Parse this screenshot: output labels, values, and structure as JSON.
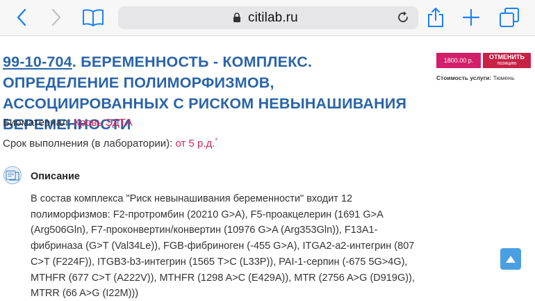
{
  "browser": {
    "url": "citilab.ru"
  },
  "test": {
    "code": "99-10-704",
    "title_rest": ". БЕРЕМЕННОСТЬ - КОМПЛЕКС. ОПРЕДЕЛЕНИЕ ПОЛИМОРФИЗМОВ, АССОЦИИРОВАННЫХ С РИСКОМ НЕВЫНАШИВАНИЯ БЕРЕМЕННОСТИ",
    "price": "1800.00 р.",
    "cancel_line1": "ОТМЕНИТЬ",
    "cancel_line2": "позицию",
    "cost_label": "Стоимость услуги:",
    "cost_city": "Тюмень",
    "biomaterial_label": "Биоматериал:",
    "biomaterial_value": "Кровь ЭДТА",
    "term_label": "Срок выполнения (в лаборатории):",
    "term_value": "от 5 р.д.",
    "term_star": "*"
  },
  "description": {
    "heading": "Описание",
    "text": "В состав комплекса \"Риск невынашивания беременности\" входит 12 полиморфизмов: F2-протромбин (20210 G>A), F5-проакцелерин (1691 G>A (Arg506Gln), F7-проконвертин/конвертин (10976 G>A (Arg353Gln)), F13A1-фибриназа (G>T (Val34Le)), FGB-фибриноген (-455 G>A), ITGA2-а2-интегрин (807 C>T (F224F)), ITGB3-b3-интегрин (1565 T>C (L33P)), PAI-1-серпин (-675 5G>4G), MTHFR (677 C>T (A222V)), MTHFR (1298 A>C (E429A)), MTR (2756 A>G (D919G)), MTRR (66 A>G (I22M)))"
  },
  "colors": {
    "ios_blue": "#1a82fb",
    "title_blue": "#2a64a8",
    "accent_pink": "#d0245d",
    "price_bg": "#d31f6a",
    "cancel_bg": "#c82146",
    "scroll_btn": "#4a9fe3"
  },
  "icons": {
    "back": "chevron-left-icon",
    "forward": "chevron-right-icon",
    "bookmarks": "book-icon",
    "lock": "lock-icon",
    "reload": "reload-icon",
    "share": "share-icon",
    "new_tab": "plus-icon",
    "tabs": "tabs-icon",
    "description": "document-icon",
    "scroll_top": "arrow-up-icon"
  }
}
